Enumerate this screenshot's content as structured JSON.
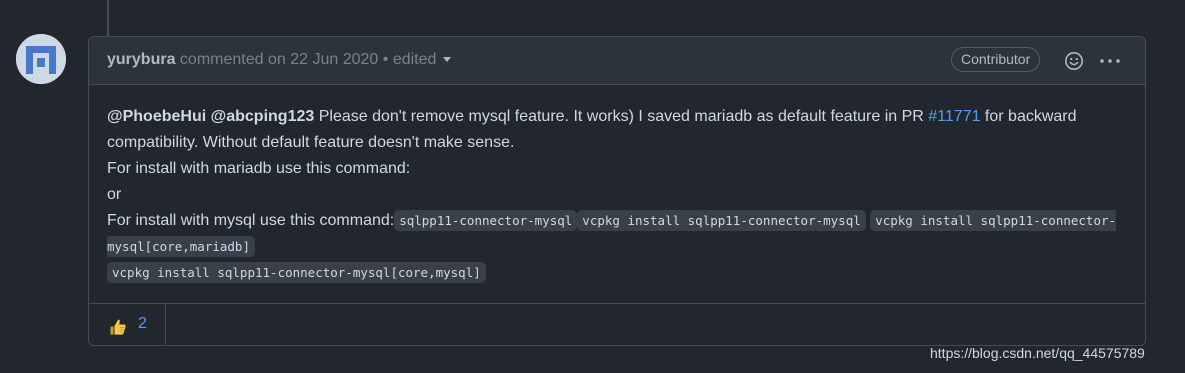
{
  "comment": {
    "author": "yurybura",
    "action": "commented on",
    "date": "22 Jun 2020",
    "separator": "•",
    "edited": "edited",
    "badge": "Contributor",
    "body": {
      "mention1": "@PhoebeHui",
      "mention2": "@abcping123",
      "text1": " Please don't remove mysql feature. It works) I saved mariadb as default feature in PR ",
      "pr_link": "#11771",
      "text2": " for backward compatibility. Without default feature doesn't make sense.",
      "line2": "For install with mariadb use this command:",
      "line3": "or",
      "line4": "For install with mysql use this command:",
      "code1": "sqlpp11-connector-mysql",
      "code2": "vcpkg install sqlpp11-connector-mysql",
      "code3": "vcpkg install sqlpp11-connector-mysql[core,mariadb]",
      "code4": "vcpkg install sqlpp11-connector-mysql[core,mysql]"
    },
    "reaction": {
      "icon": "thumbs-up-icon",
      "count": "2"
    }
  },
  "watermark": "https://blog.csdn.net/qq_44575789"
}
